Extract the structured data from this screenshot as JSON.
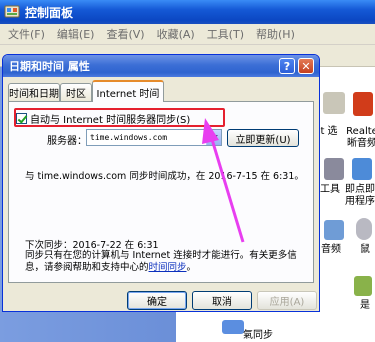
{
  "control_panel": {
    "title": "控制面板",
    "menu": [
      "文件(F)",
      "编辑(E)",
      "查看(V)",
      "收藏(A)",
      "工具(T)",
      "帮助(H)"
    ],
    "icons": [
      {
        "label": "t 选",
        "color": "#c9c6b8"
      },
      {
        "label": "Realte\n晰音频",
        "color": "#d13c1a"
      },
      {
        "label": "工具",
        "color": "#8a8a9c"
      },
      {
        "label": "即点即\n用程序",
        "color": "#4d8bd8"
      },
      {
        "label": "音频",
        "color": "#6f9cd6"
      },
      {
        "label": "鼠",
        "color": "#b9b9c2"
      },
      {
        "label": "是",
        "color": "#89b24a"
      },
      {
        "label": "氣同步",
        "color": "#5b8ee0"
      }
    ]
  },
  "dialog": {
    "title": "日期和时间 属性",
    "help_glyph": "?",
    "close_glyph": "✕",
    "tabs": [
      "时间和日期",
      "时区",
      "Internet 时间"
    ],
    "sync_checkbox_label": "自动与 Internet 时间服务器同步(S)",
    "sync_checked": true,
    "server_label": "服务器：",
    "server_value": "time.windows.com",
    "update_button": "立即更新(U)",
    "status_message": "与 time.windows.com 同步时间成功，在 2016-7-15 在 6:31。",
    "next_sync": "下次同步：2016-7-22 在 6:31",
    "note_text": "同步只有在您的计算机与 Internet 连接时才能进行。有关更多信息，请参阅帮助和支持中心的",
    "note_link": "时间同步",
    "note_end": "。",
    "ok_button": "确定",
    "cancel_button": "取消",
    "apply_button": "应用(A)"
  },
  "colors": {
    "highlight_box": "#e5202e",
    "arrow": "#e83ef0",
    "xp_blue": "#0b47c2"
  }
}
